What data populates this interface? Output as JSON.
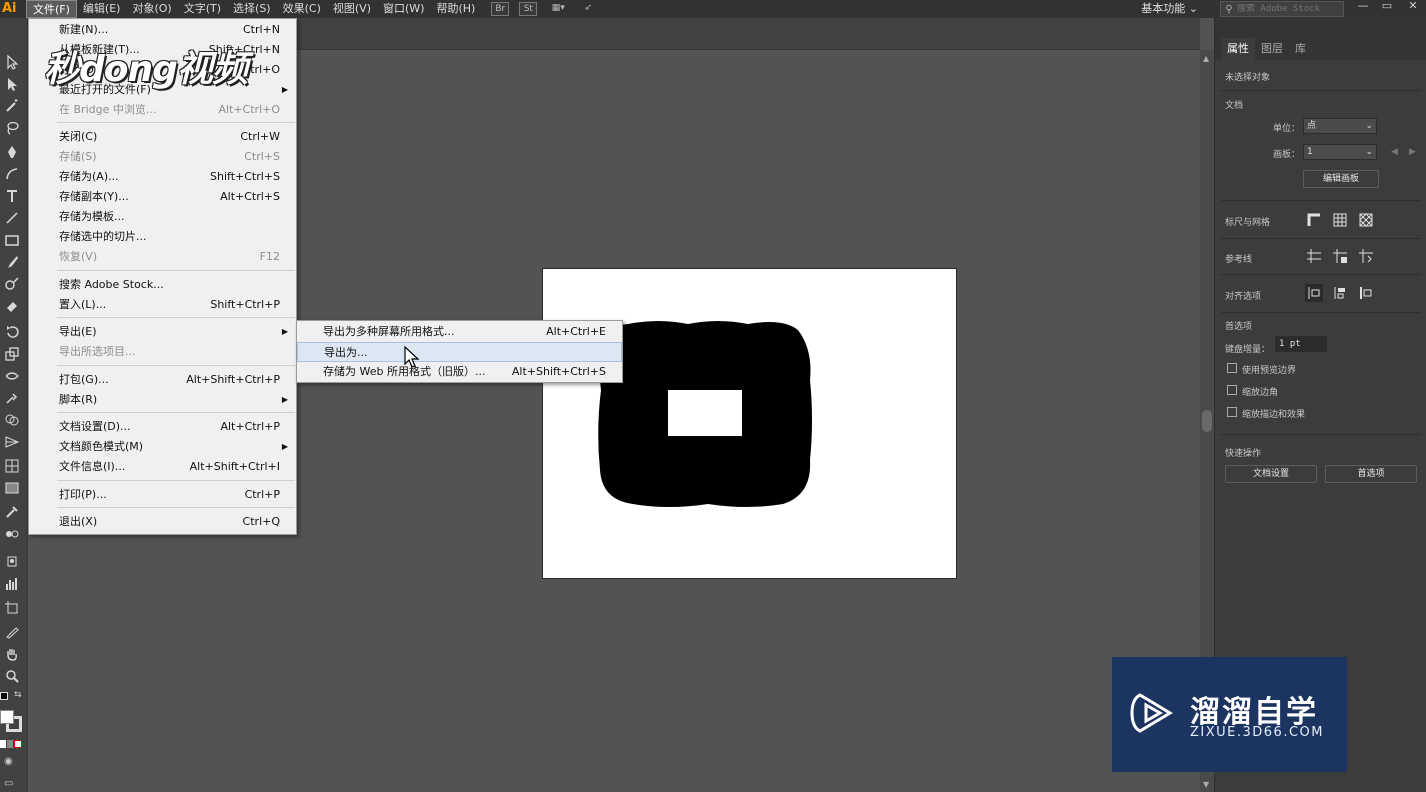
{
  "app": {
    "logo": "Ai"
  },
  "menubar": {
    "items": [
      "文件(F)",
      "编辑(E)",
      "对象(O)",
      "文字(T)",
      "选择(S)",
      "效果(C)",
      "视图(V)",
      "窗口(W)",
      "帮助(H)"
    ],
    "active_index": 0,
    "icons": [
      "Br",
      "St"
    ],
    "workspace_label": "基本功能",
    "search_placeholder": "搜索 Adobe Stock"
  },
  "file_menu": {
    "items": [
      {
        "label": "新建(N)...",
        "shortcut": "Ctrl+N",
        "disabled": false
      },
      {
        "label": "从模板新建(T)...",
        "shortcut": "Shift+Ctrl+N",
        "disabled": false
      },
      {
        "label": "打开(O)...",
        "shortcut": "Ctrl+O",
        "disabled": false
      },
      {
        "label": "最近打开的文件(F)",
        "shortcut": "",
        "disabled": false,
        "submenu": true
      },
      {
        "label": "在 Bridge 中浏览...",
        "shortcut": "Alt+Ctrl+O",
        "disabled": true
      },
      {
        "label": "关闭(C)",
        "shortcut": "Ctrl+W",
        "disabled": false
      },
      {
        "label": "存储(S)",
        "shortcut": "Ctrl+S",
        "disabled": true
      },
      {
        "label": "存储为(A)...",
        "shortcut": "Shift+Ctrl+S",
        "disabled": false
      },
      {
        "label": "存储副本(Y)...",
        "shortcut": "Alt+Ctrl+S",
        "disabled": false
      },
      {
        "label": "存储为模板...",
        "shortcut": "",
        "disabled": false
      },
      {
        "label": "存储选中的切片...",
        "shortcut": "",
        "disabled": false
      },
      {
        "label": "恢复(V)",
        "shortcut": "F12",
        "disabled": true
      },
      {
        "label": "搜索 Adobe Stock...",
        "shortcut": "",
        "disabled": false
      },
      {
        "label": "置入(L)...",
        "shortcut": "Shift+Ctrl+P",
        "disabled": false
      },
      {
        "label": "导出(E)",
        "shortcut": "",
        "disabled": false,
        "submenu": true
      },
      {
        "label": "导出所选项目...",
        "shortcut": "",
        "disabled": true
      },
      {
        "label": "打包(G)...",
        "shortcut": "Alt+Shift+Ctrl+P",
        "disabled": false
      },
      {
        "label": "脚本(R)",
        "shortcut": "",
        "disabled": false,
        "submenu": true
      },
      {
        "label": "文档设置(D)...",
        "shortcut": "Alt+Ctrl+P",
        "disabled": false
      },
      {
        "label": "文档颜色模式(M)",
        "shortcut": "",
        "disabled": false,
        "submenu": true
      },
      {
        "label": "文件信息(I)...",
        "shortcut": "Alt+Shift+Ctrl+I",
        "disabled": false
      },
      {
        "label": "打印(P)...",
        "shortcut": "Ctrl+P",
        "disabled": false
      },
      {
        "label": "退出(X)",
        "shortcut": "Ctrl+Q",
        "disabled": false
      }
    ]
  },
  "export_submenu": {
    "items": [
      {
        "label": "导出为多种屏幕所用格式...",
        "shortcut": "Alt+Ctrl+E"
      },
      {
        "label": "导出为...",
        "shortcut": ""
      },
      {
        "label": "存储为 Web 所用格式（旧版）...",
        "shortcut": "Alt+Shift+Ctrl+S"
      }
    ],
    "hover_index": 1
  },
  "right_panel": {
    "tabs": [
      "属性",
      "图层",
      "库"
    ],
    "no_selection": "未选择对象",
    "document_title": "文档",
    "units_label": "单位：",
    "units_value": "点",
    "artboard_label": "画板：",
    "artboard_value": "1",
    "edit_artboards_button": "编辑画板",
    "rulers_grids_label": "标尺与网格",
    "guides_label": "参考线",
    "align_options_label": "对齐选项",
    "preferences_title": "首选项",
    "keyboard_increment_label": "键盘增量：",
    "keyboard_increment_value": "1 pt",
    "checkbox_preview_bounds": "使用预览边界",
    "checkbox_scale_corners": "缩放边角",
    "checkbox_scale_strokes": "缩放描边和效果",
    "quick_actions_title": "快速操作",
    "doc_setup_button": "文档设置",
    "preferences_button": "首选项"
  },
  "watermarks": {
    "top_left": "秒dong视频",
    "bottom_right_brand": "溜溜自学",
    "bottom_right_domain": "ZIXUE.3D66.COM"
  }
}
